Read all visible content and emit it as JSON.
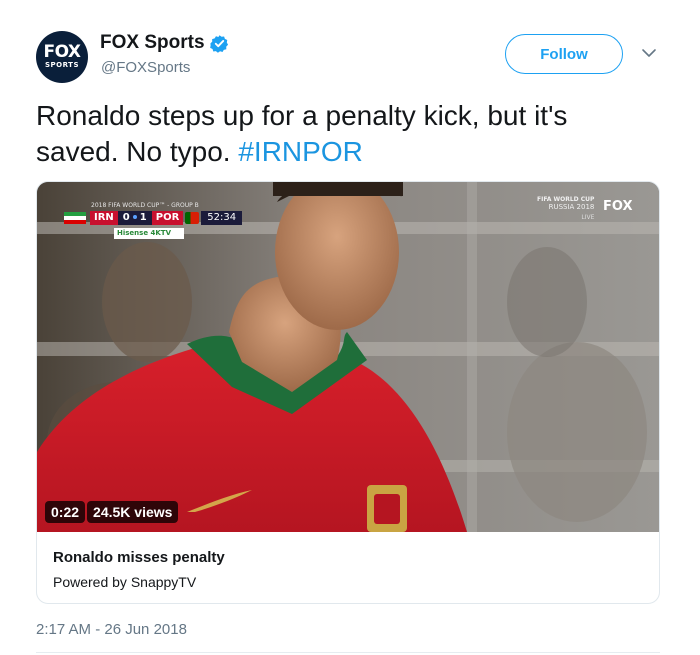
{
  "account": {
    "display_name": "FOX Sports",
    "handle": "@FOXSports",
    "avatar_line1": "FOX",
    "avatar_line2": "SPORTS",
    "verified": true
  },
  "actions": {
    "follow_label": "Follow"
  },
  "tweet": {
    "text": "Ronaldo steps up for a penalty kick, but it's saved. No typo. ",
    "hashtag": "#IRNPOR",
    "timestamp": "2:17 AM - 26 Jun 2018"
  },
  "video": {
    "duration": "0:22",
    "views": "24.5K views",
    "scorebug": {
      "header": "2018 FIFA WORLD CUP™ - GROUP B",
      "home_team": "IRN",
      "home_score": "0",
      "away_score": "1",
      "away_team": "POR",
      "clock": "52:34",
      "sponsor": "Hisense 4KTV"
    },
    "overlay_logo_line1": "FIFA WORLD CUP",
    "overlay_logo_line2": "RUSSIA 2018",
    "overlay_live": "LIVE",
    "overlay_network": "FOX"
  },
  "card": {
    "title": "Ronaldo misses penalty",
    "subtitle": "Powered by SnappyTV"
  },
  "colors": {
    "link": "#1b95e0",
    "follow": "#1da1f2",
    "muted": "#657786"
  }
}
